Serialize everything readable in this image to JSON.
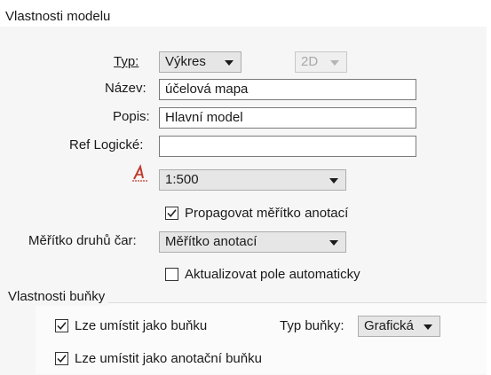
{
  "dialog": {
    "title": "Vlastnosti modelu"
  },
  "typ": {
    "label": "Typ:",
    "value": "Výkres",
    "dim_value": "2D"
  },
  "nazev": {
    "label": "Název:",
    "value": "účelová mapa"
  },
  "popis": {
    "label": "Popis:",
    "value": "Hlavní model"
  },
  "ref_logicke": {
    "label": "Ref Logické:",
    "value": ""
  },
  "annotation_scale": {
    "icon": "annotation-scale-icon",
    "value": "1:500"
  },
  "propagate": {
    "label": "Propagovat měřítko anotací",
    "checked": true
  },
  "line_style_scale": {
    "label": "Měřítko druhů čar:",
    "value": "Měřítko anotací"
  },
  "auto_update": {
    "label": "Aktualizovat pole automaticky",
    "checked": false
  },
  "cell_props": {
    "group_title": "Vlastnosti buňky",
    "place_as_cell": {
      "label": "Lze umístit jako buňku",
      "checked": true
    },
    "cell_type": {
      "label": "Typ buňky:",
      "value": "Grafická"
    },
    "place_as_annotation_cell": {
      "label": "Lze umístit jako anotační buňku",
      "checked": true
    }
  },
  "colors": {
    "accent_icon": "#c0392b"
  }
}
